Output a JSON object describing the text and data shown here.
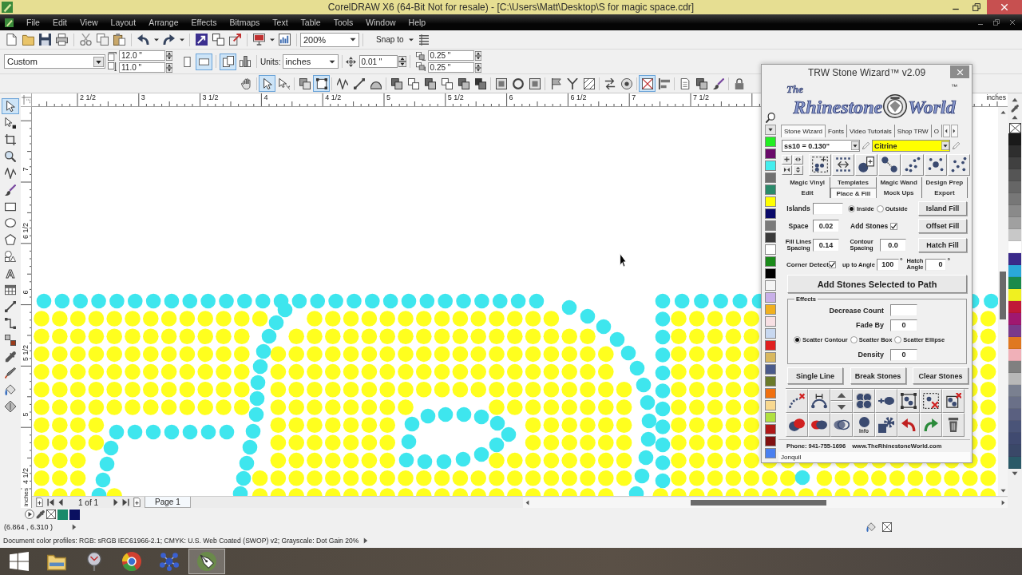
{
  "window": {
    "title": "CorelDRAW X6 (64-Bit Not for resale) - [C:\\Users\\Matt\\Desktop\\S for magic space.cdr]"
  },
  "menu": [
    "File",
    "Edit",
    "View",
    "Layout",
    "Arrange",
    "Effects",
    "Bitmaps",
    "Text",
    "Table",
    "Tools",
    "Window",
    "Help"
  ],
  "standard_toolbar": {
    "zoom": "200%",
    "snap_to": "Snap to"
  },
  "property_bar": {
    "page_size": "Custom",
    "page_width": "12.0 \"",
    "page_height": "11.0 \"",
    "orientation": [
      {
        "selected": false
      },
      {
        "selected": true
      }
    ],
    "page_scope": [
      {
        "selected": true
      },
      {
        "selected": false
      }
    ],
    "units_label": "Units:",
    "units": "inches",
    "nudge": "0.01 \"",
    "duplicate_distance": [
      "0.25 \"",
      "0.25 \""
    ]
  },
  "object_toolbar": [
    {
      "selected": false
    },
    {
      "selected": true
    },
    {
      "selected": false
    },
    {
      "selected": false
    },
    {
      "selected": true
    },
    {
      "selected": false
    },
    {
      "selected": false
    },
    {
      "selected": false
    },
    {
      "selected": false
    },
    {
      "selected": false
    },
    {
      "selected": false
    },
    {
      "selected": false
    },
    {
      "selected": false
    },
    {
      "selected": false
    },
    {
      "selected": false
    },
    {
      "selected": false
    },
    {
      "selected": false
    },
    {
      "selected": false
    },
    {
      "selected": false
    },
    {
      "selected": false
    },
    {
      "selected": false
    },
    {
      "selected": false
    },
    {
      "selected": true
    },
    {
      "selected": false
    },
    {
      "selected": false
    },
    {
      "selected": false
    },
    {
      "selected": false
    },
    {
      "selected": false
    }
  ],
  "toolbox": [
    {
      "selected": true
    },
    {
      "selected": false
    },
    {
      "selected": false
    },
    {
      "selected": false
    },
    {
      "selected": false
    },
    {
      "selected": false
    },
    {
      "selected": false
    },
    {
      "selected": false
    },
    {
      "selected": false
    },
    {
      "selected": false
    },
    {
      "selected": false,
      "glyph": "A"
    },
    {
      "selected": false
    },
    {
      "selected": false
    },
    {
      "selected": false
    },
    {
      "selected": false
    },
    {
      "selected": false
    },
    {
      "selected": false
    },
    {
      "selected": false
    },
    {
      "selected": false
    }
  ],
  "horizontal_ruler": {
    "labels": [
      "2 1/2",
      "3",
      "3 1/2",
      "4",
      "4 1/2",
      "5",
      "5 1/2",
      "6",
      "6 1/2",
      "7",
      "7 1/2"
    ],
    "unit": "inches"
  },
  "vertical_ruler": {
    "labels": [
      "7",
      "6 1/2",
      "6",
      "5 1/2",
      "5",
      "4 1/2"
    ],
    "unit": "inches"
  },
  "page_navigator": {
    "position": "1 of 1",
    "pages": [
      {
        "label": "Page 1",
        "selected": true
      }
    ]
  },
  "status_bar": {
    "swatches": [
      {
        "color": "#1a8a6a"
      },
      {
        "color": "#0a1060"
      }
    ],
    "coordinates": "(6.864 , 6.310 )",
    "color_profiles": "Document color profiles: RGB: sRGB IEC61966-2.1; CMYK: U.S. Web Coated (SWOP) v2; Grayscale: Dot Gain 20%"
  },
  "color_palette": [
    {
      "color": "#1a1a1a"
    },
    {
      "color": "#2e2e2e"
    },
    {
      "color": "#404040"
    },
    {
      "color": "#555555"
    },
    {
      "color": "#666666"
    },
    {
      "color": "#777777"
    },
    {
      "color": "#8a8a8a"
    },
    {
      "color": "#a0a0a0"
    },
    {
      "color": "#c8c8c8"
    },
    {
      "color": "#ffffff"
    },
    {
      "color": "#3a2a8a"
    },
    {
      "color": "#2aa8d8"
    },
    {
      "color": "#1a8a4a"
    },
    {
      "color": "#f0f020"
    },
    {
      "color": "#c01838"
    },
    {
      "color": "#a01870"
    },
    {
      "color": "#7a3a8a"
    },
    {
      "color": "#e07820"
    },
    {
      "color": "#f0b0b8"
    },
    {
      "color": "#808080"
    },
    {
      "color": "#b8b8b8"
    },
    {
      "color": "#7a8090"
    },
    {
      "color": "#6a7088"
    },
    {
      "color": "#5a6080"
    },
    {
      "color": "#4a5478"
    },
    {
      "color": "#404a70"
    },
    {
      "color": "#3a4868"
    },
    {
      "color": "#2a5a68"
    }
  ],
  "stone_wizard": {
    "title": "TRW Stone Wizard™ v2.09",
    "logo": {
      "small": "The",
      "words": [
        "Rhinestone",
        "World"
      ],
      "mark": "™"
    },
    "stone_colors": [
      {
        "color": "#22ee22"
      },
      {
        "color": "#6a0a6a"
      },
      {
        "color": "#44eeee"
      },
      {
        "color": "#707070"
      },
      {
        "color": "#2a8a6a"
      },
      {
        "color": "#ffff00"
      },
      {
        "color": "#0a0a6a"
      },
      {
        "color": "#7a7a7a"
      },
      {
        "color": "#3a3a3a"
      },
      {
        "color": "#ffffff"
      },
      {
        "color": "#1a8a1a"
      },
      {
        "color": "#000000"
      },
      {
        "color": "#f4f4f4"
      },
      {
        "color": "#c8b0e8"
      },
      {
        "color": "#f0b020"
      },
      {
        "color": "#f8e0e4"
      },
      {
        "color": "#c8d8f0"
      },
      {
        "color": "#e02020"
      },
      {
        "color": "#d8b860"
      },
      {
        "color": "#4a5a8a"
      },
      {
        "color": "#6a7a2a"
      },
      {
        "color": "#f07010"
      },
      {
        "color": "#f8d890"
      },
      {
        "color": "#b0e040"
      },
      {
        "color": "#b01818"
      },
      {
        "color": "#801010"
      },
      {
        "color": "#4a80f0"
      }
    ],
    "tabs": [
      {
        "label": "Stone Wizard",
        "selected": true
      },
      {
        "label": "Fonts",
        "selected": false
      },
      {
        "label": "Video Tutorials",
        "selected": false
      },
      {
        "label": "Shop TRW",
        "selected": false
      },
      {
        "label": "O",
        "selected": false
      }
    ],
    "stone_size": "ss10 = 0.130\"",
    "stone_color": {
      "value": "Citrine",
      "color": "#ffff00"
    },
    "sub_tab_rows": [
      [
        {
          "label": "Magic Vinyl",
          "selected": false
        },
        {
          "label": "Templates",
          "selected": false
        },
        {
          "label": "Magic Wand",
          "selected": false
        },
        {
          "label": "Design Prep",
          "selected": false
        }
      ],
      [
        {
          "label": "Edit",
          "selected": false
        },
        {
          "label": "Place & Fill",
          "selected": true
        },
        {
          "label": "Mock Ups",
          "selected": false
        },
        {
          "label": "Export",
          "selected": false
        }
      ]
    ],
    "islands": {
      "label": "Islands"
    },
    "island_side": [
      {
        "label": "Inside",
        "selected": true
      },
      {
        "label": "Outside",
        "selected": false
      }
    ],
    "space": {
      "label": "Space",
      "value": "0.02"
    },
    "add_stones": {
      "label": "Add Stones",
      "checked": true
    },
    "fill_lines_spacing": {
      "label": "Fill Lines Spacing",
      "value": "0.14"
    },
    "contour_spacing": {
      "label": "Contour Spacing",
      "value": "0.0"
    },
    "corner_detect": {
      "label": "Corner Detect",
      "checked": true
    },
    "angle": {
      "label": "up to Angle",
      "value": "100",
      "unit": "°"
    },
    "hatch_angle": {
      "label": "Hatch Angle",
      "value": "0",
      "unit": "°"
    },
    "fill_buttons": [
      "Island Fill",
      "Offset Fill",
      "Hatch Fill"
    ],
    "path_button": "Add Stones Selected to Path",
    "effects": {
      "title": "Effects",
      "decrease_count": {
        "label": "Decrease Count"
      },
      "fade_by": {
        "label": "Fade By",
        "value": "0"
      },
      "scatter": [
        {
          "label": "Scatter Contour",
          "selected": true
        },
        {
          "label": "Scatter Box",
          "selected": false
        },
        {
          "label": "Scatter Ellipse",
          "selected": false
        }
      ],
      "density": {
        "label": "Density",
        "value": "0"
      }
    },
    "buttons": [
      "Single Line",
      "Break Stones",
      "Clear Stones"
    ],
    "info_label": "Info",
    "phone": "Phone: 941-755-1696",
    "website": "www.TheRhinestoneWorld.com",
    "color_name": "Jonquil"
  }
}
